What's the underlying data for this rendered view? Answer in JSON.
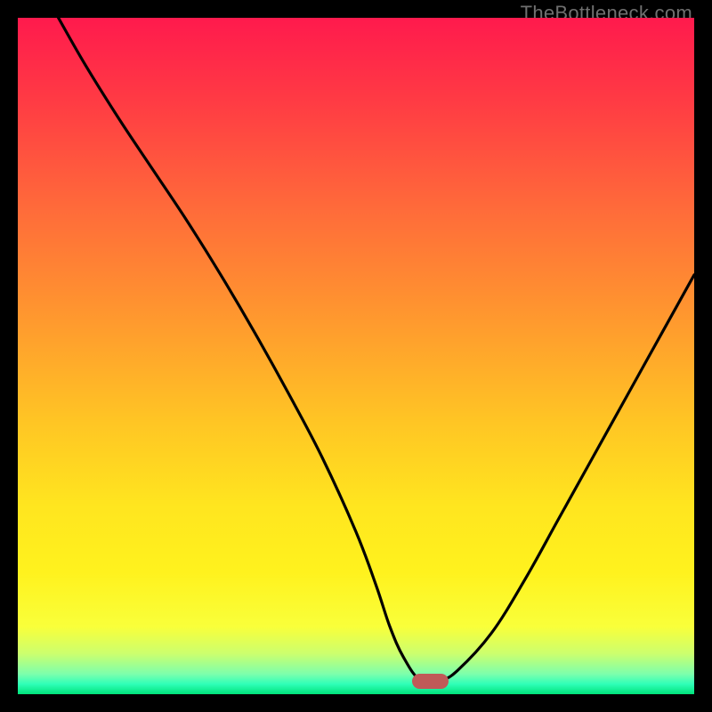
{
  "watermark": "TheBottleneck.com",
  "colors": {
    "frame": "#000000",
    "watermark": "#6f6f6f",
    "curve": "#000000",
    "marker": "#c05a58",
    "gradient_stops": [
      {
        "offset": 0.0,
        "color": "#ff1a4d"
      },
      {
        "offset": 0.12,
        "color": "#ff3a44"
      },
      {
        "offset": 0.28,
        "color": "#ff6a3a"
      },
      {
        "offset": 0.45,
        "color": "#ff9a2e"
      },
      {
        "offset": 0.6,
        "color": "#ffc624"
      },
      {
        "offset": 0.72,
        "color": "#ffe51f"
      },
      {
        "offset": 0.82,
        "color": "#fff21e"
      },
      {
        "offset": 0.9,
        "color": "#f9ff3a"
      },
      {
        "offset": 0.94,
        "color": "#ccff6e"
      },
      {
        "offset": 0.97,
        "color": "#7dffac"
      },
      {
        "offset": 0.985,
        "color": "#2fffb8"
      },
      {
        "offset": 1.0,
        "color": "#00e27a"
      }
    ]
  },
  "chart_data": {
    "type": "line",
    "title": "",
    "xlabel": "",
    "ylabel": "",
    "xlim": [
      0,
      100
    ],
    "ylim": [
      0,
      100
    ],
    "series": [
      {
        "name": "bottleneck-curve",
        "x": [
          6,
          10,
          15,
          20,
          25,
          30,
          35,
          40,
          45,
          50,
          53,
          55,
          57,
          59.5,
          62.5,
          65,
          70,
          75,
          80,
          85,
          90,
          95,
          100
        ],
        "y": [
          100,
          93,
          85,
          77.5,
          70,
          62,
          53.5,
          44.5,
          35,
          24,
          16,
          10,
          5.5,
          2.1,
          2.1,
          3.5,
          9,
          17,
          26,
          35,
          44,
          53,
          62
        ]
      }
    ],
    "marker": {
      "x_center": 61,
      "y": 1.9,
      "width_pct": 5.5,
      "height_pct": 2.2
    }
  }
}
